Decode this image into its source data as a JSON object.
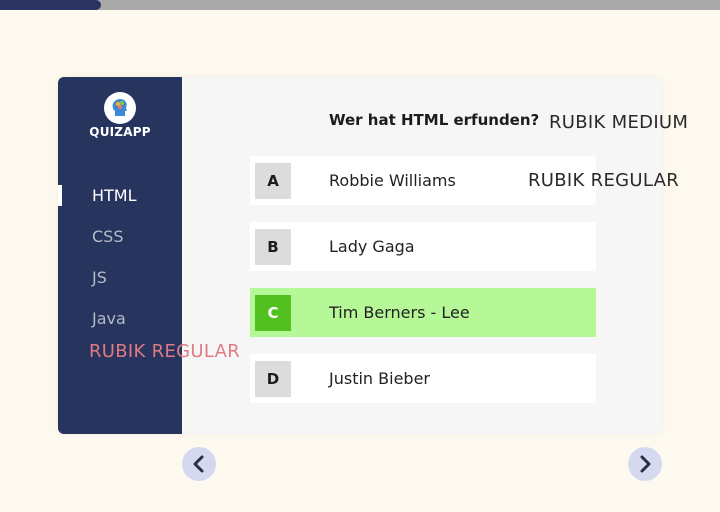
{
  "progress": {
    "fraction": 0.14
  },
  "app": {
    "brand": "QUIZAPP",
    "logo_icon": "brain-head-icon"
  },
  "sidebar": {
    "items": [
      {
        "label": "HTML",
        "active": true
      },
      {
        "label": "CSS",
        "active": false
      },
      {
        "label": "JS",
        "active": false
      },
      {
        "label": "Java",
        "active": false
      }
    ]
  },
  "quiz": {
    "question": "Wer hat HTML erfunden?",
    "options": [
      {
        "letter": "A",
        "text": "Robbie Williams",
        "selected": false
      },
      {
        "letter": "B",
        "text": "Lady Gaga",
        "selected": false
      },
      {
        "letter": "C",
        "text": "Tim Berners - Lee",
        "selected": true
      },
      {
        "letter": "D",
        "text": "Justin Bieber",
        "selected": false
      }
    ]
  },
  "navigation": {
    "prev_icon": "chevron-left-icon",
    "next_icon": "chevron-right-icon"
  },
  "annotations": {
    "heading_font": "RUBIK MEDIUM",
    "answer_font": "RUBIK REGULAR",
    "sidebar_font": "RUBIK REGULAR"
  },
  "colors": {
    "sidebar": "#27345e",
    "selected_option": "#b6f798",
    "selected_letter": "#52c11f",
    "background": "#fef9ee",
    "nav_button": "#d5d9ef"
  }
}
